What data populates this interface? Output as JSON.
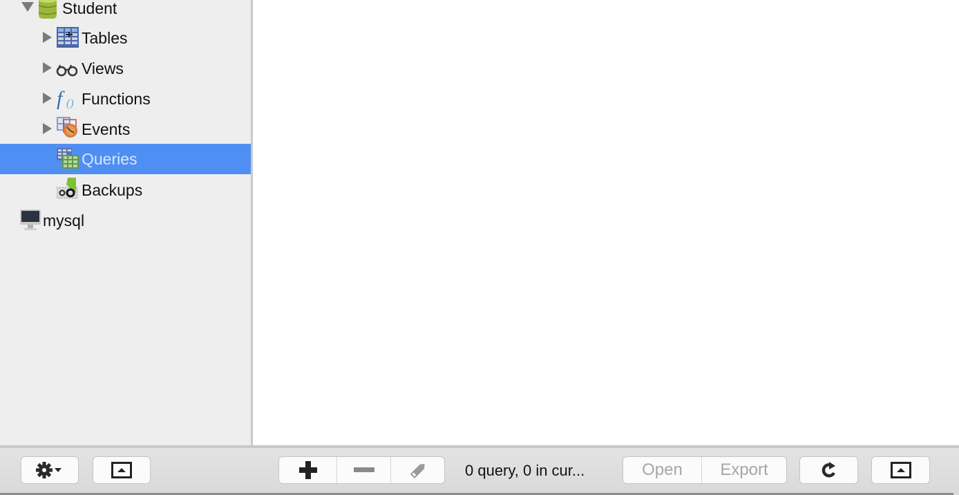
{
  "sidebar": {
    "database": {
      "label": "Student",
      "icon": "database-icon",
      "expanded": true
    },
    "items": [
      {
        "label": "Tables",
        "icon": "tables-icon",
        "has_children": true
      },
      {
        "label": "Views",
        "icon": "views-glasses-icon",
        "has_children": true
      },
      {
        "label": "Functions",
        "icon": "functions-icon",
        "has_children": true
      },
      {
        "label": "Events",
        "icon": "events-icon",
        "has_children": true
      },
      {
        "label": "Queries",
        "icon": "queries-icon",
        "has_children": false,
        "selected": true
      },
      {
        "label": "Backups",
        "icon": "backups-icon",
        "has_children": false
      }
    ],
    "server": {
      "label": "mysql",
      "icon": "server-monitor-icon"
    }
  },
  "toolbar": {
    "gear_menu": "gear-icon",
    "toggle_sidebar_left": "panel-toggle-icon",
    "add": "plus-icon",
    "remove": "minus-icon",
    "edit": "pencil-icon",
    "status_text": "0 query, 0 in cur...",
    "open_label": "Open",
    "export_label": "Export",
    "refresh": "refresh-icon",
    "toggle_panel_right": "panel-toggle-icon"
  },
  "colors": {
    "selection": "#4f8ff3",
    "sidebar_bg": "#efeeee"
  }
}
